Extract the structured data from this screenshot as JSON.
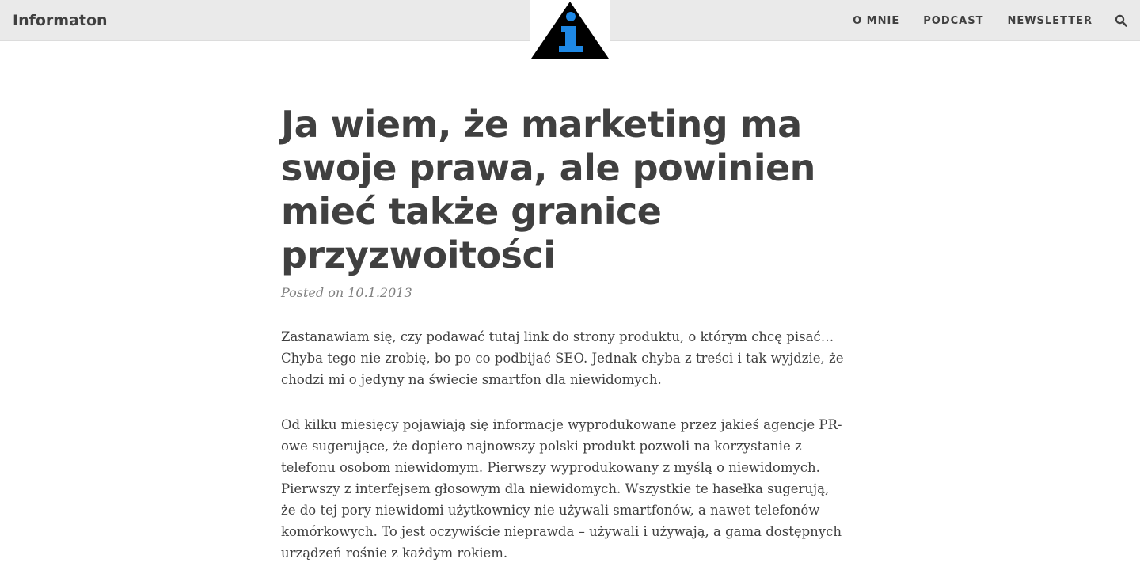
{
  "header": {
    "brand": "Informaton",
    "logo": "info-triangle-logo",
    "nav": [
      {
        "label": "O MNIE"
      },
      {
        "label": "PODCAST"
      },
      {
        "label": "NEWSLETTER"
      }
    ],
    "search_icon": "search-icon",
    "colors": {
      "bar_bg": "#eaeaea",
      "logo_triangle": "#000000",
      "logo_glyph": "#1e88e5"
    }
  },
  "post": {
    "title": "Ja wiem, że marketing ma swoje prawa, ale powinien mieć także granice przyzwoitości",
    "meta_prefix": "Posted on",
    "date": "10.1.2013",
    "paragraphs": [
      "Zastanawiam się, czy podawać tutaj link do strony produktu, o którym chcę pisać… Chyba tego nie zrobię, bo po co podbijać SEO. Jednak chyba z treści i tak wyjdzie, że chodzi mi o jedyny na świecie smartfon dla niewidomych.",
      "Od kilku miesięcy pojawiają się informacje wyprodukowane przez jakieś agencje PR-owe sugerujące, że dopiero najnowszy polski produkt pozwoli na korzystanie z telefonu osobom niewidomym. Pierwszy wyprodukowany z myślą o niewidomych. Pierwszy z interfejsem głosowym dla niewidomych. Wszystkie te hasełka sugerują, że do tej pory niewidomi użytkownicy nie używali smartfonów, a nawet telefonów komórkowych. To jest oczywiście nieprawda – używali i używają, a gama dostępnych urządzeń rośnie z każdym rokiem."
    ]
  }
}
